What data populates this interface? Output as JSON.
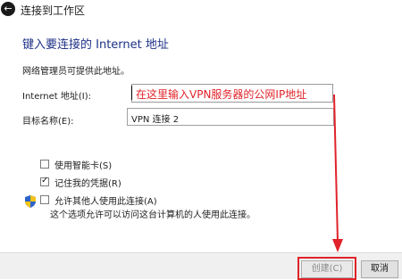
{
  "window": {
    "title": "连接到工作区"
  },
  "icons": {
    "back": "back-arrow-icon",
    "shield": "uac-shield-icon"
  },
  "heading": "键入要连接的 Internet 地址",
  "subtext": "网络管理员可提供此地址。",
  "form": {
    "internet_address": {
      "label": "Internet 地址(I):",
      "value": "在这里输入VPN服务器的公网IP地址"
    },
    "destination_name": {
      "label": "目标名称(E):",
      "value": "VPN 连接 2"
    }
  },
  "options": [
    {
      "label": "使用智能卡(S)",
      "checked": false
    },
    {
      "label": "记住我的凭据(R)",
      "checked": true
    },
    {
      "label": "允许其他人使用此连接(A)",
      "checked": false
    }
  ],
  "allow_others_description": "这个选项允许可以访问这台计算机的人使用此连接。",
  "buttons": {
    "create": "创建(C)",
    "cancel": "取消"
  },
  "colors": {
    "annotation": "#e0232a",
    "heading": "#1e3287"
  }
}
